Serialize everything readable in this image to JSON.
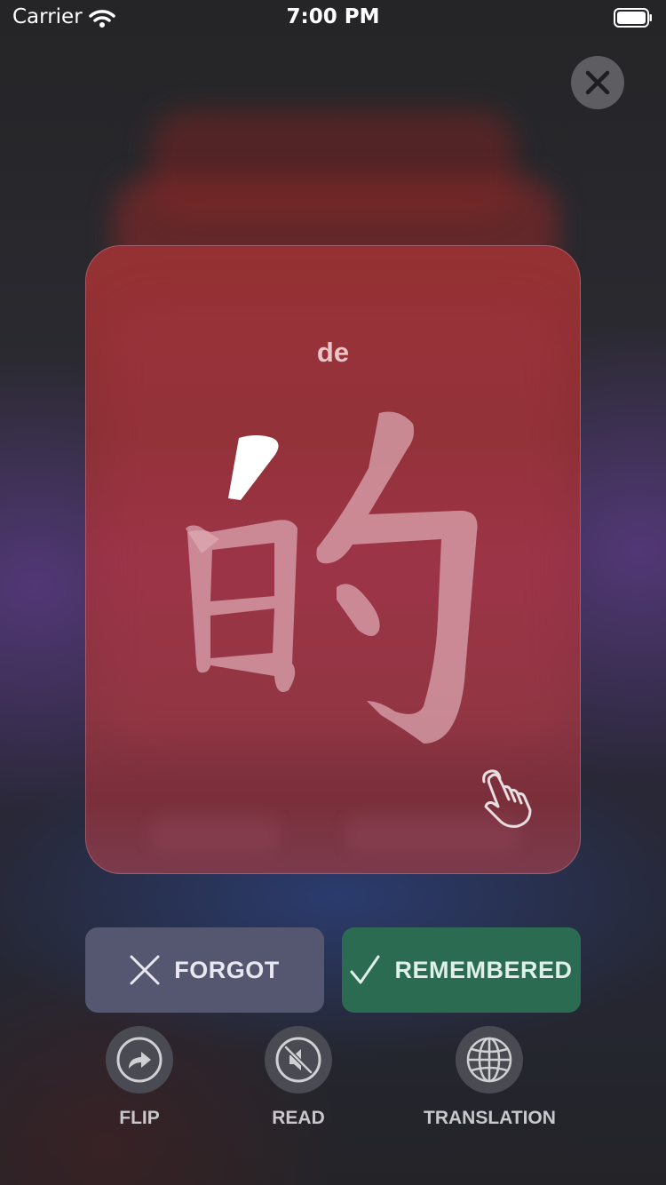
{
  "status_bar": {
    "carrier": "Carrier",
    "time": "7:00 PM"
  },
  "card": {
    "pinyin": "de",
    "character": "的"
  },
  "actions": {
    "forgot_label": "FORGOT",
    "remembered_label": "REMEMBERED"
  },
  "tools": [
    {
      "label": "FLIP",
      "icon": "flip-icon"
    },
    {
      "label": "READ",
      "icon": "speaker-muted-icon"
    },
    {
      "label": "TRANSLATION",
      "icon": "globe-icon"
    }
  ],
  "colors": {
    "card": "#953133",
    "forgot_button": "#555670",
    "remembered_button": "#2a6b52",
    "tool_circle": "#4a4b52"
  }
}
